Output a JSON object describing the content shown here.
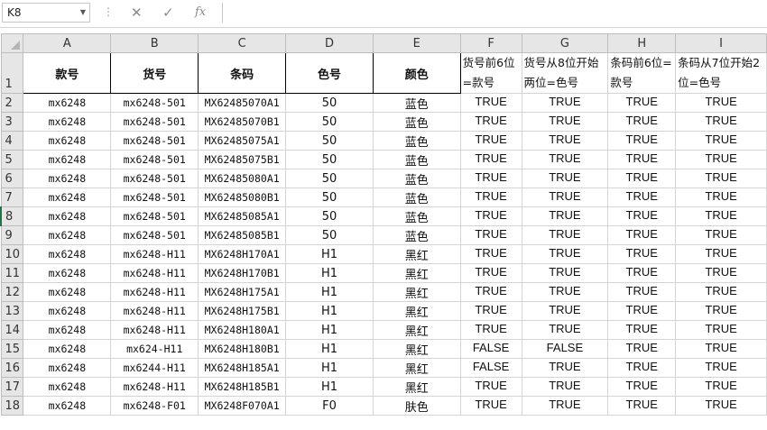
{
  "formula_bar": {
    "name_box": "K8",
    "cancel_icon": "✕",
    "enter_icon": "✓",
    "fx_icon": "fx",
    "formula": ""
  },
  "columns": [
    "A",
    "B",
    "C",
    "D",
    "E",
    "F",
    "G",
    "H",
    "I"
  ],
  "header_row": {
    "row_number": "1",
    "cells": [
      "款号",
      "货号",
      "条码",
      "色号",
      "颜色",
      "货号前6位=款号",
      "货号从8位开始两位=色号",
      "条码前6位=款号",
      "条码从7位开始2位=色号"
    ]
  },
  "rows": [
    {
      "n": "2",
      "cells": [
        "mx6248",
        "mx6248-501",
        "MX62485070A1",
        "50",
        "蓝色",
        "TRUE",
        "TRUE",
        "TRUE",
        "TRUE"
      ]
    },
    {
      "n": "3",
      "cells": [
        "mx6248",
        "mx6248-501",
        "MX62485070B1",
        "50",
        "蓝色",
        "TRUE",
        "TRUE",
        "TRUE",
        "TRUE"
      ]
    },
    {
      "n": "4",
      "cells": [
        "mx6248",
        "mx6248-501",
        "MX62485075A1",
        "50",
        "蓝色",
        "TRUE",
        "TRUE",
        "TRUE",
        "TRUE"
      ]
    },
    {
      "n": "5",
      "cells": [
        "mx6248",
        "mx6248-501",
        "MX62485075B1",
        "50",
        "蓝色",
        "TRUE",
        "TRUE",
        "TRUE",
        "TRUE"
      ]
    },
    {
      "n": "6",
      "cells": [
        "mx6248",
        "mx6248-501",
        "MX62485080A1",
        "50",
        "蓝色",
        "TRUE",
        "TRUE",
        "TRUE",
        "TRUE"
      ]
    },
    {
      "n": "7",
      "cells": [
        "mx6248",
        "mx6248-501",
        "MX62485080B1",
        "50",
        "蓝色",
        "TRUE",
        "TRUE",
        "TRUE",
        "TRUE"
      ]
    },
    {
      "n": "8",
      "cells": [
        "mx6248",
        "mx6248-501",
        "MX62485085A1",
        "50",
        "蓝色",
        "TRUE",
        "TRUE",
        "TRUE",
        "TRUE"
      ]
    },
    {
      "n": "9",
      "cells": [
        "mx6248",
        "mx6248-501",
        "MX62485085B1",
        "50",
        "蓝色",
        "TRUE",
        "TRUE",
        "TRUE",
        "TRUE"
      ]
    },
    {
      "n": "10",
      "cells": [
        "mx6248",
        "mx6248-H11",
        "MX6248H170A1",
        "H1",
        "黑红",
        "TRUE",
        "TRUE",
        "TRUE",
        "TRUE"
      ]
    },
    {
      "n": "11",
      "cells": [
        "mx6248",
        "mx6248-H11",
        "MX6248H170B1",
        "H1",
        "黑红",
        "TRUE",
        "TRUE",
        "TRUE",
        "TRUE"
      ]
    },
    {
      "n": "12",
      "cells": [
        "mx6248",
        "mx6248-H11",
        "MX6248H175A1",
        "H1",
        "黑红",
        "TRUE",
        "TRUE",
        "TRUE",
        "TRUE"
      ]
    },
    {
      "n": "13",
      "cells": [
        "mx6248",
        "mx6248-H11",
        "MX6248H175B1",
        "H1",
        "黑红",
        "TRUE",
        "TRUE",
        "TRUE",
        "TRUE"
      ]
    },
    {
      "n": "14",
      "cells": [
        "mx6248",
        "mx6248-H11",
        "MX6248H180A1",
        "H1",
        "黑红",
        "TRUE",
        "TRUE",
        "TRUE",
        "TRUE"
      ]
    },
    {
      "n": "15",
      "cells": [
        "mx6248",
        "mx624-H11",
        "MX6248H180B1",
        "H1",
        "黑红",
        "FALSE",
        "FALSE",
        "TRUE",
        "TRUE"
      ]
    },
    {
      "n": "16",
      "cells": [
        "mx6248",
        "mx6244-H11",
        "MX6248H185A1",
        "H1",
        "黑红",
        "FALSE",
        "TRUE",
        "TRUE",
        "TRUE"
      ]
    },
    {
      "n": "17",
      "cells": [
        "mx6248",
        "mx6248-H11",
        "MX6248H185B1",
        "H1",
        "黑红",
        "TRUE",
        "TRUE",
        "TRUE",
        "TRUE"
      ]
    },
    {
      "n": "18",
      "cells": [
        "mx6248",
        "mx6248-F01",
        "MX6248F070A1",
        "F0",
        "肤色",
        "TRUE",
        "TRUE",
        "TRUE",
        "TRUE"
      ]
    }
  ],
  "colors": {
    "header_bg": "#e6e6e6",
    "grid_line": "#d4d4d4",
    "active_row_marker": "#217346"
  }
}
